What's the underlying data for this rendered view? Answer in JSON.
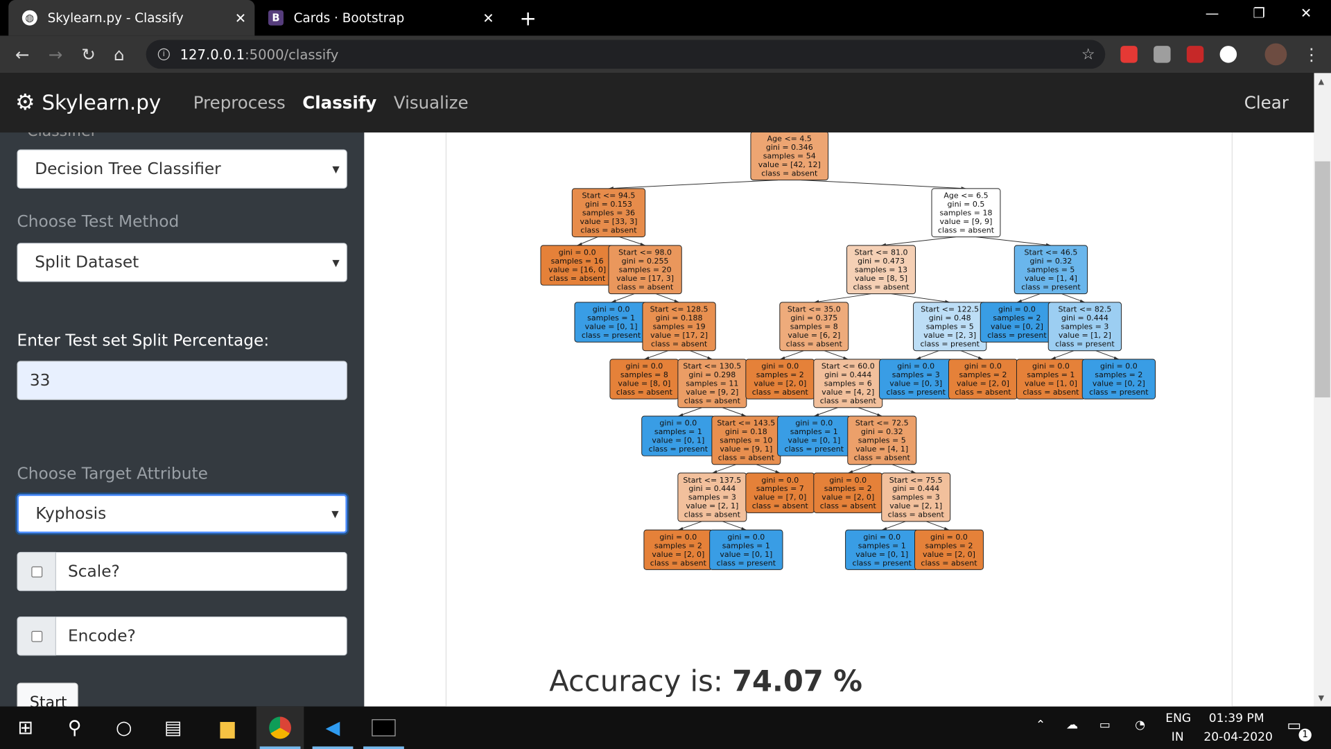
{
  "browser": {
    "tabs": [
      {
        "title": "Skylearn.py - Classify",
        "favicon": "globe-icon",
        "active": true
      },
      {
        "title": "Cards · Bootstrap",
        "favicon": "bootstrap-icon",
        "favicon_letter": "B",
        "active": false
      }
    ],
    "url_host": "127.0.0.1",
    "url_path": ":5000/classify"
  },
  "navbar": {
    "brand": "Skylearn.py",
    "links": [
      "Preprocess",
      "Classify",
      "Visualize"
    ],
    "active_link": "Classify",
    "clear": "Clear"
  },
  "sidebar": {
    "cut_label": "Classifier",
    "classifier_value": "Decision Tree Classifier",
    "test_method_label": "Choose Test Method",
    "test_method_value": "Split Dataset",
    "split_label": "Enter Test set Split Percentage:",
    "split_value": "33",
    "target_label": "Choose Target Attribute",
    "target_value": "Kyphosis",
    "scale_label": "Scale?",
    "encode_label": "Encode?",
    "start_label": "Start"
  },
  "tree": {
    "nodes": [
      {
        "id": "n0",
        "lines": [
          "Age <= 4.5",
          "gini = 0.346",
          "samples = 54",
          "value = [42, 12]",
          "class = absent"
        ],
        "fill": "#eda572"
      },
      {
        "id": "n1",
        "lines": [
          "Start <= 94.5",
          "gini = 0.153",
          "samples = 36",
          "value = [33, 3]",
          "class = absent"
        ],
        "fill": "#e78c4b"
      },
      {
        "id": "n2",
        "lines": [
          "Age <= 6.5",
          "gini = 0.5",
          "samples = 18",
          "value = [9, 9]",
          "class = absent"
        ],
        "fill": "#ffffff"
      },
      {
        "id": "n3",
        "lines": [
          "gini = 0.0",
          "samples = 16",
          "value = [16, 0]",
          "class = absent"
        ],
        "fill": "#e58139"
      },
      {
        "id": "n4",
        "lines": [
          "Start <= 98.0",
          "gini = 0.255",
          "samples = 20",
          "value = [17, 3]",
          "class = absent"
        ],
        "fill": "#ea975c"
      },
      {
        "id": "n5",
        "lines": [
          "Start <= 81.0",
          "gini = 0.473",
          "samples = 13",
          "value = [8, 5]",
          "class = absent"
        ],
        "fill": "#f5d0b5"
      },
      {
        "id": "n6",
        "lines": [
          "Start <= 46.5",
          "gini = 0.32",
          "samples = 5",
          "value = [1, 4]",
          "class = present"
        ],
        "fill": "#6ab6ec"
      },
      {
        "id": "n7",
        "lines": [
          "gini = 0.0",
          "samples = 1",
          "value = [0, 1]",
          "class = present"
        ],
        "fill": "#399de5"
      },
      {
        "id": "n8",
        "lines": [
          "Start <= 128.5",
          "gini = 0.188",
          "samples = 19",
          "value = [17, 2]",
          "class = absent"
        ],
        "fill": "#e89050"
      },
      {
        "id": "n9",
        "lines": [
          "Start <= 35.0",
          "gini = 0.375",
          "samples = 8",
          "value = [6, 2]",
          "class = absent"
        ],
        "fill": "#eeab7b"
      },
      {
        "id": "n10",
        "lines": [
          "Start <= 122.5",
          "gini = 0.48",
          "samples = 5",
          "value = [2, 3]",
          "class = present"
        ],
        "fill": "#bddef6"
      },
      {
        "id": "n11",
        "lines": [
          "gini = 0.0",
          "samples = 2",
          "value = [0, 2]",
          "class = present"
        ],
        "fill": "#399de5"
      },
      {
        "id": "n12",
        "lines": [
          "Start <= 82.5",
          "gini = 0.444",
          "samples = 3",
          "value = [1, 2]",
          "class = present"
        ],
        "fill": "#9ccef2"
      },
      {
        "id": "n13",
        "lines": [
          "gini = 0.0",
          "samples = 8",
          "value = [8, 0]",
          "class = absent"
        ],
        "fill": "#e58139"
      },
      {
        "id": "n14",
        "lines": [
          "Start <= 130.5",
          "gini = 0.298",
          "samples = 11",
          "value = [9, 2]",
          "class = absent"
        ],
        "fill": "#eb9d65"
      },
      {
        "id": "n15",
        "lines": [
          "gini = 0.0",
          "samples = 2",
          "value = [2, 0]",
          "class = absent"
        ],
        "fill": "#e58139"
      },
      {
        "id": "n16",
        "lines": [
          "Start <= 60.0",
          "gini = 0.444",
          "samples = 6",
          "value = [4, 2]",
          "class = absent"
        ],
        "fill": "#f2c09c"
      },
      {
        "id": "n17",
        "lines": [
          "gini = 0.0",
          "samples = 3",
          "value = [0, 3]",
          "class = present"
        ],
        "fill": "#399de5"
      },
      {
        "id": "n18",
        "lines": [
          "gini = 0.0",
          "samples = 2",
          "value = [2, 0]",
          "class = absent"
        ],
        "fill": "#e58139"
      },
      {
        "id": "n19",
        "lines": [
          "gini = 0.0",
          "samples = 1",
          "value = [1, 0]",
          "class = absent"
        ],
        "fill": "#e58139"
      },
      {
        "id": "n20",
        "lines": [
          "gini = 0.0",
          "samples = 2",
          "value = [0, 2]",
          "class = present"
        ],
        "fill": "#399de5"
      },
      {
        "id": "n21",
        "lines": [
          "gini = 0.0",
          "samples = 1",
          "value = [0, 1]",
          "class = present"
        ],
        "fill": "#399de5"
      },
      {
        "id": "n22",
        "lines": [
          "Start <= 143.5",
          "gini = 0.18",
          "samples = 10",
          "value = [9, 1]",
          "class = absent"
        ],
        "fill": "#e88f4f"
      },
      {
        "id": "n23",
        "lines": [
          "gini = 0.0",
          "samples = 1",
          "value = [0, 1]",
          "class = present"
        ],
        "fill": "#399de5"
      },
      {
        "id": "n24",
        "lines": [
          "Start <= 72.5",
          "gini = 0.32",
          "samples = 5",
          "value = [4, 1]",
          "class = absent"
        ],
        "fill": "#eca06a"
      },
      {
        "id": "n25",
        "lines": [
          "Start <= 137.5",
          "gini = 0.444",
          "samples = 3",
          "value = [2, 1]",
          "class = absent"
        ],
        "fill": "#f2c09c"
      },
      {
        "id": "n26",
        "lines": [
          "gini = 0.0",
          "samples = 7",
          "value = [7, 0]",
          "class = absent"
        ],
        "fill": "#e58139"
      },
      {
        "id": "n27",
        "lines": [
          "gini = 0.0",
          "samples = 2",
          "value = [2, 0]",
          "class = absent"
        ],
        "fill": "#e58139"
      },
      {
        "id": "n28",
        "lines": [
          "Start <= 75.5",
          "gini = 0.444",
          "samples = 3",
          "value = [2, 1]",
          "class = absent"
        ],
        "fill": "#f2c09c"
      },
      {
        "id": "n29",
        "lines": [
          "gini = 0.0",
          "samples = 2",
          "value = [2, 0]",
          "class = absent"
        ],
        "fill": "#e58139"
      },
      {
        "id": "n30",
        "lines": [
          "gini = 0.0",
          "samples = 1",
          "value = [0, 1]",
          "class = present"
        ],
        "fill": "#399de5"
      },
      {
        "id": "n31",
        "lines": [
          "gini = 0.0",
          "samples = 1",
          "value = [0, 1]",
          "class = present"
        ],
        "fill": "#399de5"
      },
      {
        "id": "n32",
        "lines": [
          "gini = 0.0",
          "samples = 2",
          "value = [2, 0]",
          "class = absent"
        ],
        "fill": "#e58139"
      }
    ],
    "edges": [
      [
        "n0",
        "n1"
      ],
      [
        "n0",
        "n2"
      ],
      [
        "n1",
        "n3"
      ],
      [
        "n1",
        "n4"
      ],
      [
        "n2",
        "n5"
      ],
      [
        "n2",
        "n6"
      ],
      [
        "n4",
        "n7"
      ],
      [
        "n4",
        "n8"
      ],
      [
        "n5",
        "n9"
      ],
      [
        "n5",
        "n10"
      ],
      [
        "n6",
        "n11"
      ],
      [
        "n6",
        "n12"
      ],
      [
        "n8",
        "n13"
      ],
      [
        "n8",
        "n14"
      ],
      [
        "n9",
        "n15"
      ],
      [
        "n9",
        "n16"
      ],
      [
        "n10",
        "n17"
      ],
      [
        "n10",
        "n18"
      ],
      [
        "n12",
        "n19"
      ],
      [
        "n12",
        "n20"
      ],
      [
        "n14",
        "n21"
      ],
      [
        "n14",
        "n22"
      ],
      [
        "n16",
        "n23"
      ],
      [
        "n16",
        "n24"
      ],
      [
        "n22",
        "n25"
      ],
      [
        "n22",
        "n26"
      ],
      [
        "n24",
        "n27"
      ],
      [
        "n24",
        "n28"
      ],
      [
        "n25",
        "n29"
      ],
      [
        "n25",
        "n30"
      ],
      [
        "n28",
        "n31"
      ],
      [
        "n28",
        "n32"
      ]
    ]
  },
  "result": {
    "accuracy_label": "Accuracy is:",
    "accuracy_value": "74.07 %"
  },
  "taskbar": {
    "lang_top": "ENG",
    "lang_bottom": "IN",
    "time": "01:39 PM",
    "date": "20-04-2020",
    "notifications": "1"
  }
}
